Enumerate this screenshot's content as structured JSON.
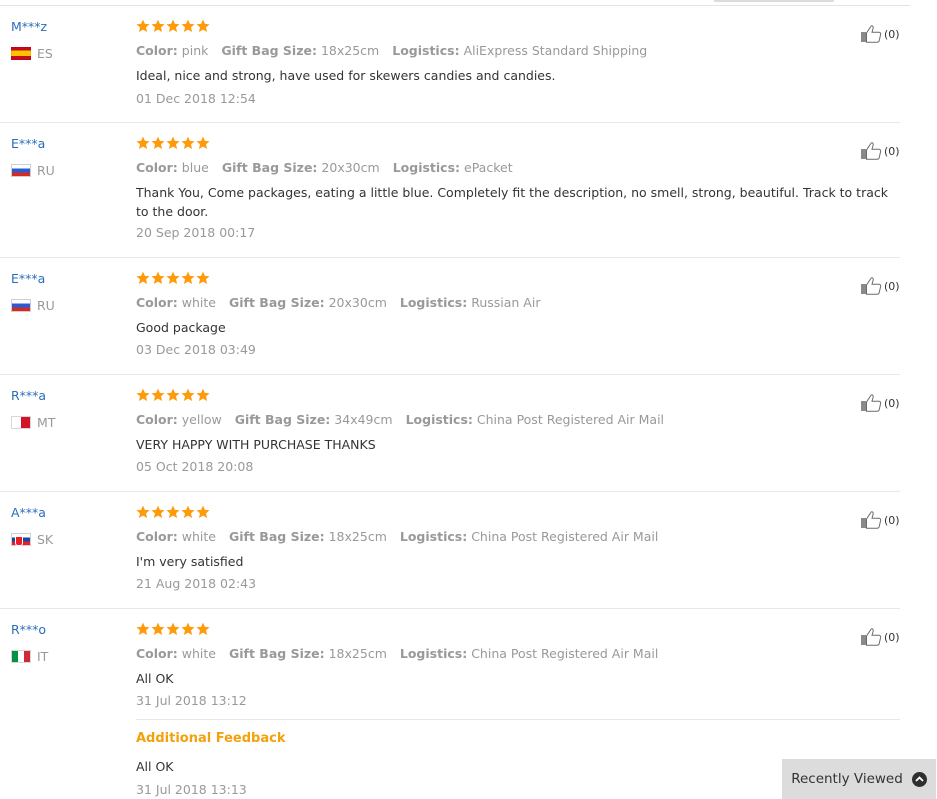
{
  "colors": {
    "star": "#ff9a0b",
    "username": "#2a6ebb",
    "additional_feedback": "#f3a10c",
    "muted_text": "#999999"
  },
  "labels": {
    "color": "Color:",
    "size": "Gift Bag Size:",
    "logistics": "Logistics:"
  },
  "reviews": [
    {
      "user": "M***z",
      "country": "ES",
      "flag": "spain-flag-icon",
      "rating": 5,
      "helpful_count": "(0)",
      "color": "pink",
      "size": "18x25cm",
      "logistics": "AliExpress Standard Shipping",
      "text": "Ideal, nice and strong, have used for skewers candies and candies.",
      "date": "01 Dec 2018 12:54"
    },
    {
      "user": "E***a",
      "country": "RU",
      "flag": "russia-flag-icon",
      "rating": 5,
      "helpful_count": "(0)",
      "color": "blue",
      "size": "20x30cm",
      "logistics": "ePacket",
      "text": "Thank You, Come packages, eating a little blue. Completely fit the description, no smell, strong, beautiful. Track to track to the door.",
      "date": "20 Sep 2018 00:17"
    },
    {
      "user": "E***a",
      "country": "RU",
      "flag": "russia-flag-icon",
      "rating": 5,
      "helpful_count": "(0)",
      "color": "white",
      "size": "20x30cm",
      "logistics": "Russian Air",
      "text": "Good package",
      "date": "03 Dec 2018 03:49"
    },
    {
      "user": "R***a",
      "country": "MT",
      "flag": "malta-flag-icon",
      "rating": 5,
      "helpful_count": "(0)",
      "color": "yellow",
      "size": "34x49cm",
      "logistics": "China Post Registered Air Mail",
      "text": "VERY HAPPY WITH PURCHASE THANKS",
      "date": "05 Oct 2018 20:08"
    },
    {
      "user": "A***a",
      "country": "SK",
      "flag": "slovakia-flag-icon",
      "rating": 5,
      "helpful_count": "(0)",
      "color": "white",
      "size": "18x25cm",
      "logistics": "China Post Registered Air Mail",
      "text": "I'm very satisfied",
      "date": "21 Aug 2018 02:43"
    },
    {
      "user": "R***o",
      "country": "IT",
      "flag": "italy-flag-icon",
      "rating": 5,
      "helpful_count": "(0)",
      "color": "white",
      "size": "18x25cm",
      "logistics": "China Post Registered Air Mail",
      "text": "All OK",
      "date": "31 Jul 2018 13:12"
    }
  ],
  "additional_feedback": {
    "title": "Additional Feedback",
    "text": "All OK",
    "date": "31 Jul 2018 13:13"
  },
  "recently_viewed": {
    "label": "Recently Viewed",
    "icon": "chevron-up-icon"
  }
}
